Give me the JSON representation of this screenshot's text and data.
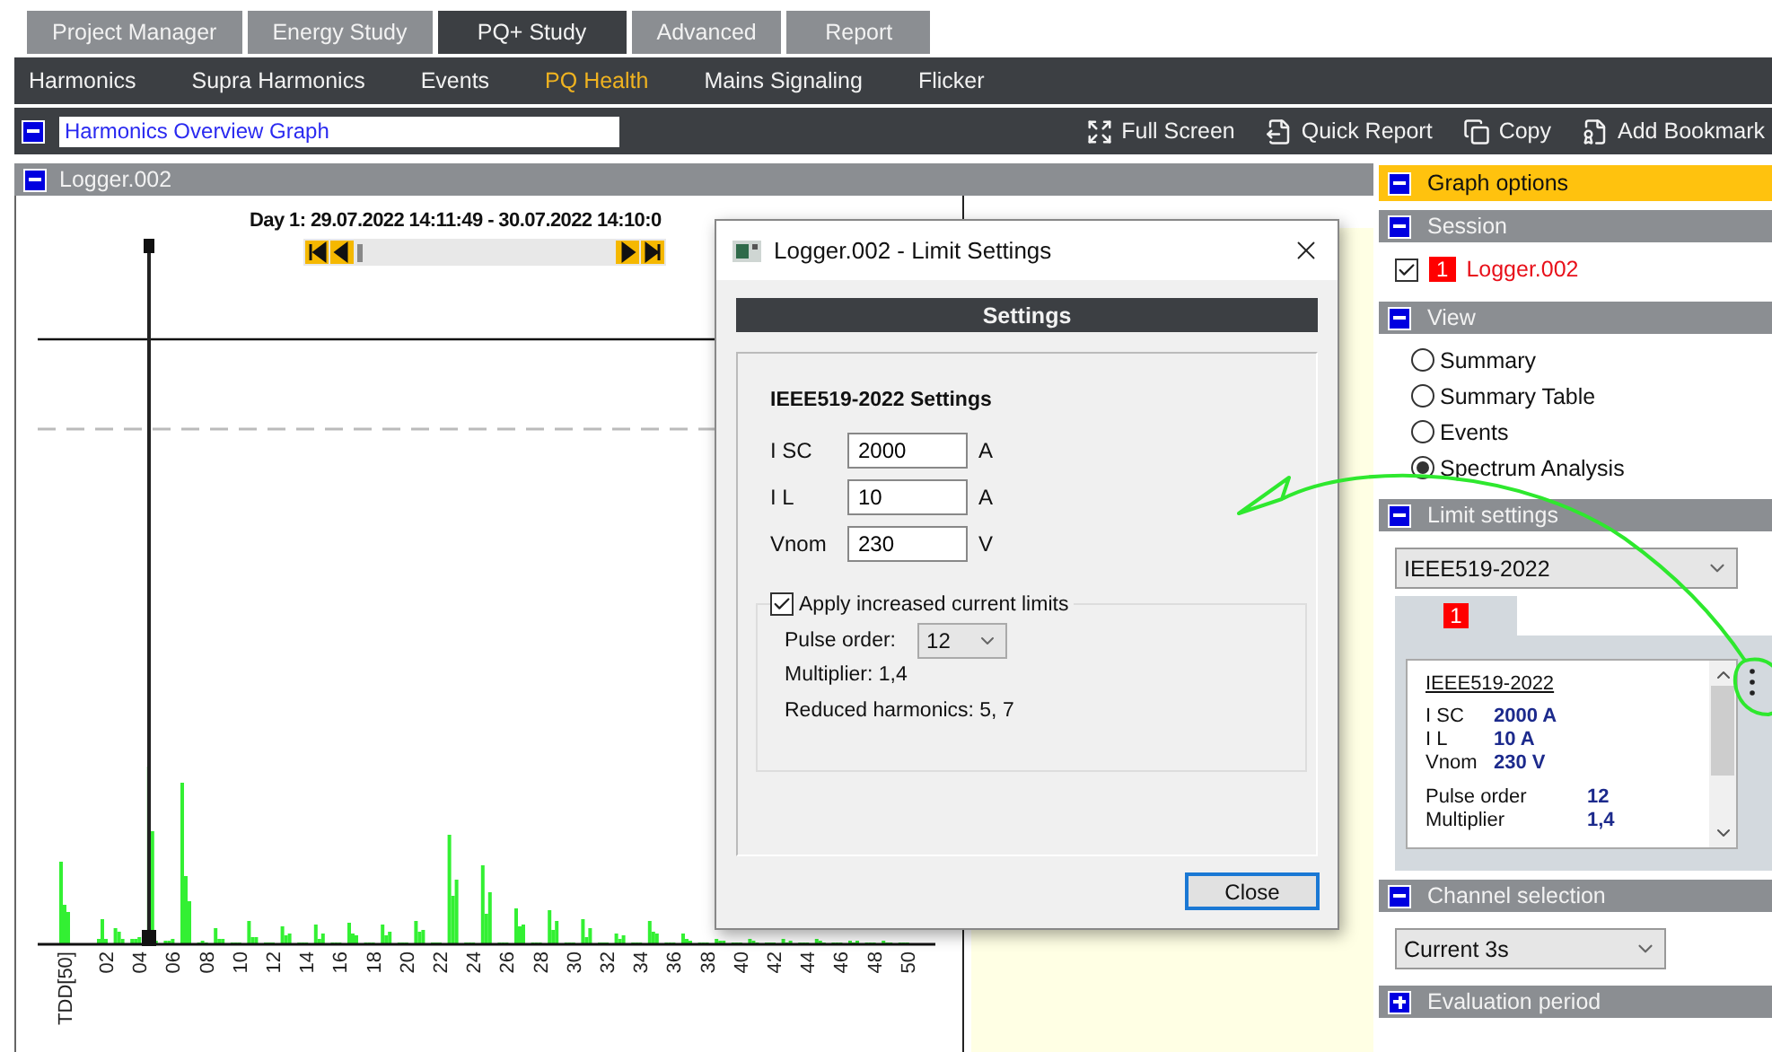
{
  "top_tabs": [
    {
      "label": "Project Manager",
      "selected": false
    },
    {
      "label": "Energy Study",
      "selected": false
    },
    {
      "label": "PQ+ Study",
      "selected": true
    },
    {
      "label": "Advanced",
      "selected": false
    },
    {
      "label": "Report",
      "selected": false
    }
  ],
  "nav": [
    {
      "label": "Harmonics",
      "selected": false
    },
    {
      "label": "Supra Harmonics",
      "selected": false
    },
    {
      "label": "Events",
      "selected": false
    },
    {
      "label": "PQ Health",
      "selected": true
    },
    {
      "label": "Mains Signaling",
      "selected": false
    },
    {
      "label": "Flicker",
      "selected": false
    }
  ],
  "toolbar": {
    "expanded": true,
    "title_field": "Harmonics Overview Graph",
    "actions": [
      {
        "kind": "fullscreen",
        "label": "Full Screen"
      },
      {
        "kind": "report",
        "label": "Quick Report"
      },
      {
        "kind": "copy",
        "label": "Copy"
      },
      {
        "kind": "bookmark",
        "label": "Add Bookmark"
      }
    ]
  },
  "graph_panel": {
    "title": "Logger.002",
    "expanded": true,
    "date_range": "Day 1: 29.07.2022 14:11:49 - 30.07.2022 14:10:0",
    "x_labels": [
      "TDD[50]",
      "02",
      "04",
      "06",
      "08",
      "10",
      "12",
      "14",
      "16",
      "18",
      "20",
      "22",
      "24",
      "26",
      "28",
      "30",
      "32",
      "34",
      "36",
      "38",
      "40",
      "42",
      "44",
      "46",
      "48",
      "50"
    ]
  },
  "dialog": {
    "title": "Logger.002 - Limit Settings",
    "header": "Settings",
    "group_title": "IEEE519-2022 Settings",
    "fields": [
      {
        "label": "I SC",
        "value": "2000",
        "unit": "A"
      },
      {
        "label": "I L",
        "value": "10",
        "unit": "A"
      },
      {
        "label": "Vnom",
        "value": "230",
        "unit": "V"
      }
    ],
    "increased_limits": {
      "label": "Apply increased current limits",
      "checked": true,
      "pulse_order_label": "Pulse order:",
      "pulse_order": "12",
      "multiplier": "Multiplier: 1,4",
      "reduced": "Reduced harmonics: 5, 7"
    },
    "close": "Close"
  },
  "sidebar": [
    {
      "kind": "options",
      "title": "Graph options",
      "expanded": true
    },
    {
      "kind": "session",
      "title": "Session",
      "expanded": true,
      "checked": true,
      "badge": "1",
      "name": "Logger.002"
    },
    {
      "kind": "view",
      "title": "View",
      "expanded": true,
      "options": [
        {
          "label": "Summary",
          "selected": false
        },
        {
          "label": "Summary Table",
          "selected": false
        },
        {
          "label": "Events",
          "selected": false
        },
        {
          "label": "Spectrum Analysis",
          "selected": true
        }
      ]
    },
    {
      "kind": "limits",
      "title": "Limit settings",
      "expanded": true,
      "select": "IEEE519-2022",
      "tab_badge": "1",
      "card_title": "IEEE519-2022",
      "rows": [
        {
          "label": "I SC",
          "value": "2000 A"
        },
        {
          "label": "I L",
          "value": "10 A"
        },
        {
          "label": "Vnom",
          "value": "230 V"
        }
      ],
      "rows2": [
        {
          "label": "Pulse order",
          "value": "12"
        },
        {
          "label": "Multiplier",
          "value": "1,4"
        }
      ]
    },
    {
      "kind": "channel",
      "title": "Channel selection",
      "expanded": true,
      "select": "Current 3s"
    },
    {
      "kind": "evaluation",
      "title": "Evaluation period",
      "expanded": false
    }
  ]
}
